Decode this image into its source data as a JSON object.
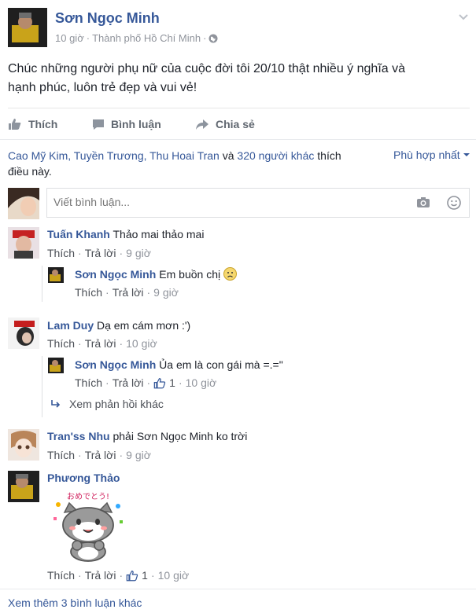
{
  "post": {
    "author": "Sơn Ngọc Minh",
    "time": "10 giờ",
    "location": "Thành phố Hồ Chí Minh",
    "text_line1": "Chúc những người phụ nữ của cuộc đời tôi 20/10 thật nhiều ý nghĩa và",
    "text_line2": "hạnh phúc, luôn trẻ đẹp và vui vẻ!"
  },
  "actions": {
    "like": "Thích",
    "comment": "Bình luận",
    "share": "Chia sẻ"
  },
  "likes": {
    "names": "Cao Mỹ Kim, Tuyền Trương, Thu Hoai Tran",
    "and": " và ",
    "others": "320 người khác",
    "suffix_line1": " thích",
    "suffix_line2": "điều này.",
    "sort": "Phù hợp nhất"
  },
  "composer": {
    "placeholder": "Viết bình luận..."
  },
  "labels": {
    "like": "Thích",
    "reply": "Trả lời"
  },
  "comments": [
    {
      "author": "Tuấn Khanh",
      "text": "Thảo mai thảo mai",
      "time": "9 giờ"
    },
    {
      "author": "Sơn Ngọc Minh",
      "text": "Em buồn chị",
      "time": "9 giờ"
    },
    {
      "author": "Lam Duy",
      "text": "Dạ em cám mơn :')",
      "time": "10 giờ"
    },
    {
      "author": "Sơn Ngọc Minh",
      "text": "Ủa em là con gái mà =.=\"",
      "time": "10 giờ",
      "likes": "1"
    },
    {
      "author": "Tran'ss Nhu",
      "text": "phải Sơn Ngọc Minh ko trời",
      "time": "9 giờ"
    },
    {
      "author": "Phương Thảo",
      "text": "",
      "time": "10 giờ",
      "likes": "1"
    }
  ],
  "more_replies": "Xem phản hồi khác",
  "sticker_text": "おめでとう!",
  "more_comments": "Xem thêm 3 bình luận khác",
  "colors": {
    "link": "#365899",
    "meta": "#90949c",
    "text": "#1d2129"
  }
}
